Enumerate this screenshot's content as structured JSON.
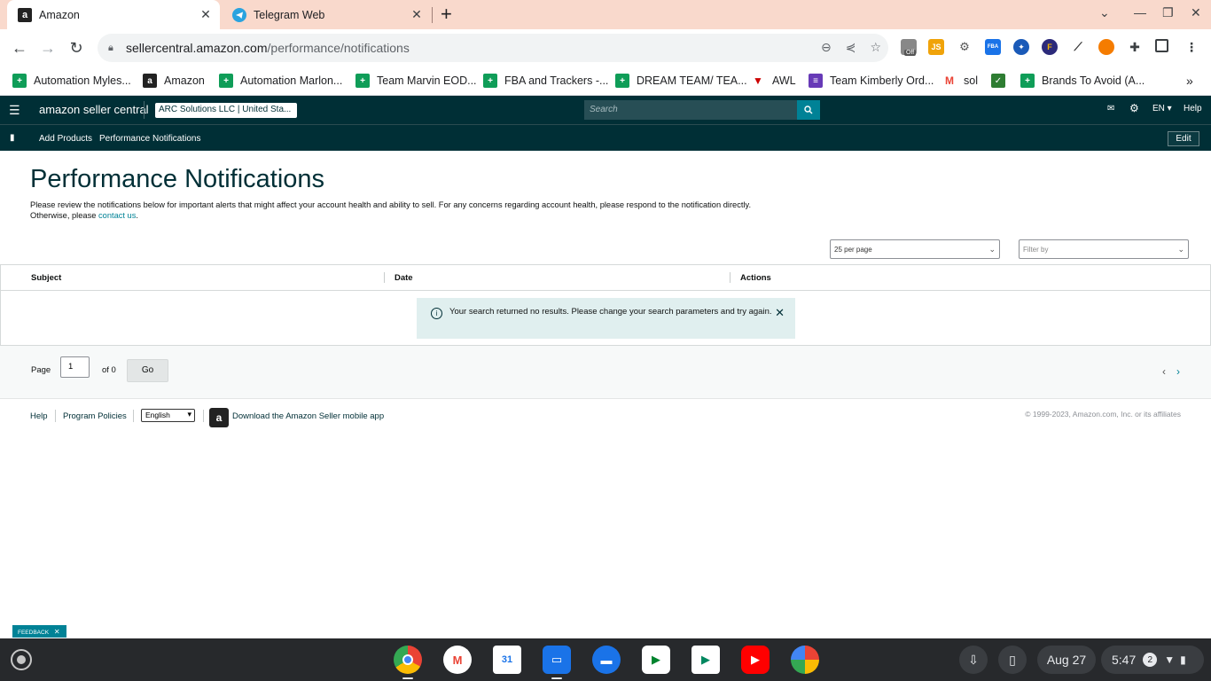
{
  "browser": {
    "tabs": [
      {
        "title": "Amazon",
        "active": true
      },
      {
        "title": "Telegram Web",
        "active": false
      }
    ],
    "url_host": "sellercentral.amazon.com",
    "url_path": "/performance/notifications",
    "extension_badge": "Off",
    "bookmarks": [
      {
        "label": "Automation Myles...",
        "icon": "sheets"
      },
      {
        "label": "Amazon",
        "icon": "amazon"
      },
      {
        "label": "Automation Marlon...",
        "icon": "sheets"
      },
      {
        "label": "Team Marvin EOD...",
        "icon": "sheets"
      },
      {
        "label": "FBA and Trackers -...",
        "icon": "sheets"
      },
      {
        "label": "DREAM TEAM/ TEA...",
        "icon": "sheets"
      },
      {
        "label": "AWL",
        "icon": "awl"
      },
      {
        "label": "Team Kimberly Ord...",
        "icon": "forms"
      },
      {
        "label": "sol",
        "icon": "gmail"
      },
      {
        "label": "Brands To Avoid (A...",
        "icon": "sheets"
      }
    ]
  },
  "seller_central": {
    "logo": "amazon seller central",
    "account": "ARC Solutions LLC | United Sta...",
    "search_placeholder": "Search",
    "language": "EN",
    "help": "Help",
    "subnav": {
      "links": [
        "Add Products",
        "Performance Notifications"
      ],
      "edit": "Edit"
    }
  },
  "page": {
    "title": "Performance Notifications",
    "description_line1": "Please review the notifications below for important alerts that might affect your account health and ability to sell. For any concerns regarding account health, please respond to the notification directly.",
    "description_line2_prefix": "Otherwise, please ",
    "description_link": "contact us",
    "description_line2_suffix": ".",
    "per_page": "25 per page",
    "filter_placeholder": "Filter by",
    "table": {
      "headers": [
        "Subject",
        "Date",
        "Actions"
      ],
      "alert": "Your search returned no results. Please change your search parameters and try again."
    },
    "pager": {
      "page_label": "Page",
      "page_value": "1",
      "of_label": "of 0",
      "go": "Go"
    },
    "footer": {
      "help": "Help",
      "program_policies": "Program Policies",
      "language": "English",
      "download_app": "Download the Amazon Seller mobile app",
      "copyright": "© 1999-2023, Amazon.com, Inc. or its affiliates"
    },
    "feedback": "FEEDBACK"
  },
  "shelf": {
    "date": "Aug 27",
    "time": "5:47",
    "notification_count": "2"
  }
}
